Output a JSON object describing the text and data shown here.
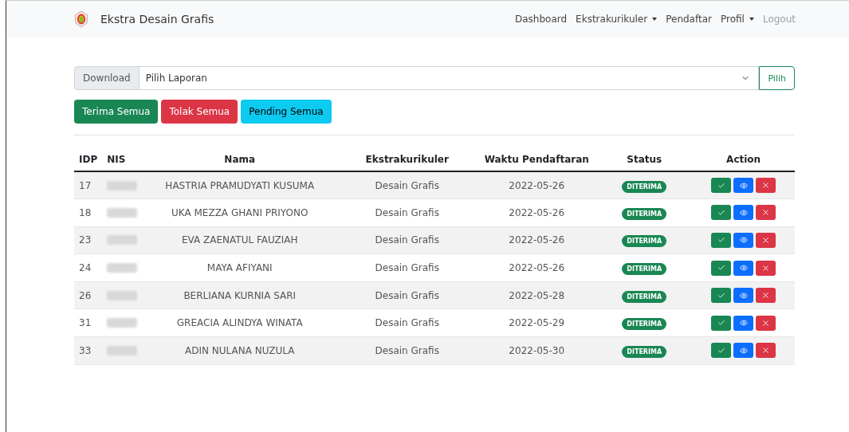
{
  "navbar": {
    "brand": "Ekstra Desain Grafis",
    "links": [
      {
        "label": "Dashboard",
        "dropdown": false,
        "disabled": false
      },
      {
        "label": "Ekstrakurikuler",
        "dropdown": true,
        "disabled": false
      },
      {
        "label": "Pendaftar",
        "dropdown": false,
        "disabled": false
      },
      {
        "label": "Profil",
        "dropdown": true,
        "disabled": false
      },
      {
        "label": "Logout",
        "dropdown": false,
        "disabled": true
      }
    ]
  },
  "report": {
    "prefix": "Download",
    "value": "Pilih Laporan",
    "button": "Pilih"
  },
  "bulk_buttons": [
    {
      "label": "Terima Semua",
      "kind": "success"
    },
    {
      "label": "Tolak Semua",
      "kind": "danger"
    },
    {
      "label": "Pending Semua",
      "kind": "info"
    }
  ],
  "table": {
    "columns": [
      "IDP",
      "NIS",
      "Nama",
      "Ekstrakurikuler",
      "Waktu Pendaftaran",
      "Status",
      "Action"
    ],
    "rows": [
      {
        "idp": "17",
        "nama": "HASTRIA PRAMUDYATI KUSUMA",
        "ekstra": "Desain Grafis",
        "waktu": "2022-05-26",
        "status": {
          "label": "DITERIMA",
          "kind": "success"
        }
      },
      {
        "idp": "18",
        "nama": "UKA MEZZA GHANI PRIYONO",
        "ekstra": "Desain Grafis",
        "waktu": "2022-05-26",
        "status": {
          "label": "DITERIMA",
          "kind": "success"
        }
      },
      {
        "idp": "23",
        "nama": "EVA ZAENATUL FAUZIAH",
        "ekstra": "Desain Grafis",
        "waktu": "2022-05-26",
        "status": {
          "label": "DITERIMA",
          "kind": "success"
        }
      },
      {
        "idp": "24",
        "nama": "MAYA AFIYANI",
        "ekstra": "Desain Grafis",
        "waktu": "2022-05-26",
        "status": {
          "label": "DITERIMA",
          "kind": "success"
        }
      },
      {
        "idp": "26",
        "nama": "BERLIANA KURNIA SARI",
        "ekstra": "Desain Grafis",
        "waktu": "2022-05-28",
        "status": {
          "label": "DITERIMA",
          "kind": "success"
        }
      },
      {
        "idp": "31",
        "nama": "GREACIA ALINDYA WINATA",
        "ekstra": "Desain Grafis",
        "waktu": "2022-05-29",
        "status": {
          "label": "DITERIMA",
          "kind": "success"
        }
      },
      {
        "idp": "33",
        "nama": "ADIN NULANA NUZULA",
        "ekstra": "Desain Grafis",
        "waktu": "2022-05-30",
        "status": {
          "label": "DITERIMA",
          "kind": "success"
        }
      }
    ]
  }
}
